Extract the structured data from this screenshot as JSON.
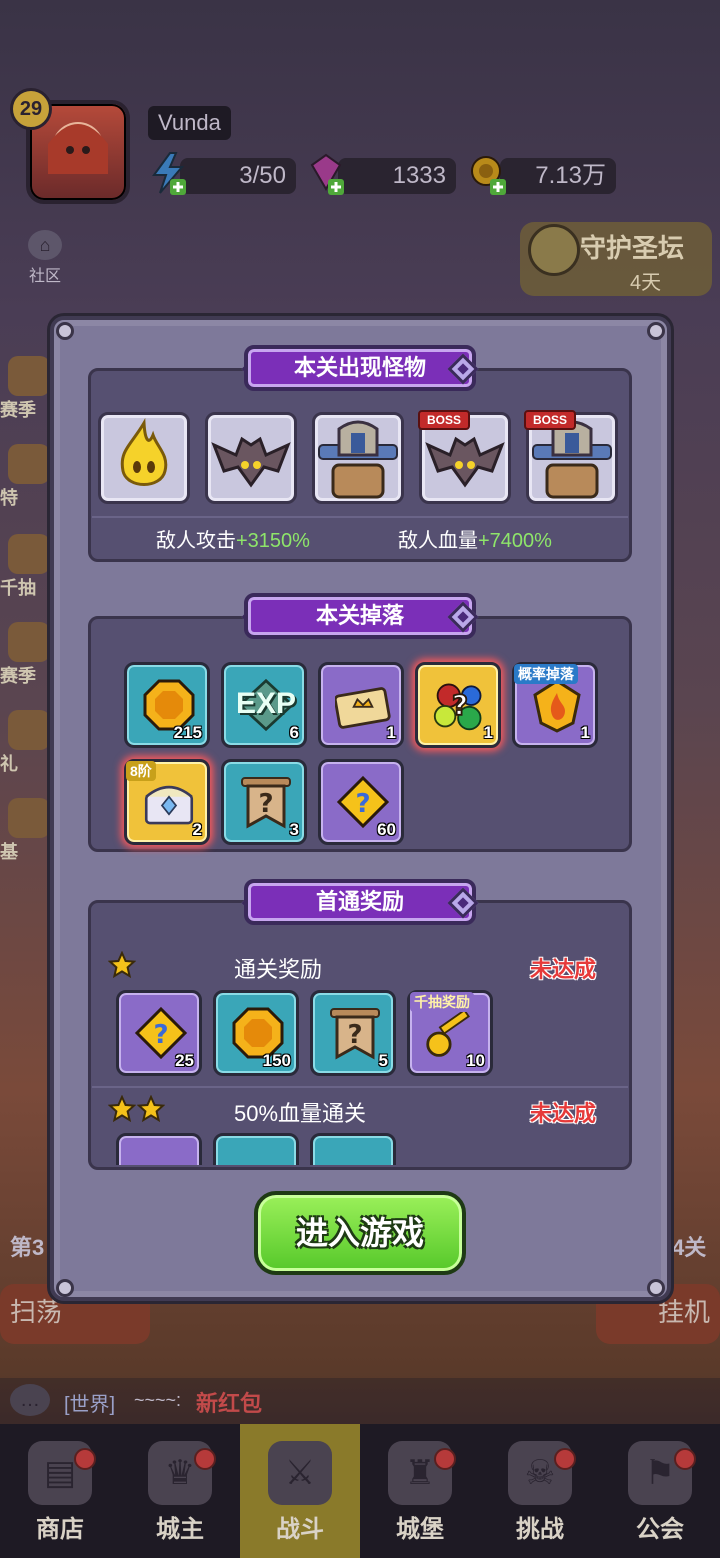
{
  "hud": {
    "level": "29",
    "name": "Vunda",
    "energy": "3/50",
    "gems": "1333",
    "gold": "7.13万",
    "community": "社区",
    "guard_title": "守护圣坛",
    "guard_days": "4天"
  },
  "side_left": [
    "赛季",
    "特",
    "千抽",
    "赛季",
    "礼",
    "基"
  ],
  "background": {
    "stage_left": "第3",
    "stage_right": "4关",
    "sweep": "扫荡",
    "hang": "挂机",
    "chat_channel": "[世界]",
    "chat_user": "~~~~:",
    "chat_msg": "新红包"
  },
  "nav": [
    {
      "label": "商店",
      "icon": "shop-icon",
      "dot": true
    },
    {
      "label": "城主",
      "icon": "crown-icon",
      "dot": true
    },
    {
      "label": "战斗",
      "icon": "swords-icon",
      "dot": false
    },
    {
      "label": "城堡",
      "icon": "castle-icon",
      "dot": true
    },
    {
      "label": "挑战",
      "icon": "demon-icon",
      "dot": true
    },
    {
      "label": "公会",
      "icon": "guild-icon",
      "dot": true
    }
  ],
  "dialog": {
    "monsters": {
      "title": "本关出现怪物",
      "list": [
        {
          "name": "fire-spirit",
          "boss": false
        },
        {
          "name": "dark-bat",
          "boss": false
        },
        {
          "name": "armored-knight",
          "boss": false
        },
        {
          "name": "dark-bat-boss",
          "boss": true
        },
        {
          "name": "armored-knight-boss",
          "boss": true
        }
      ],
      "boss_label": "BOSS",
      "atk_label": "敌人攻击",
      "atk_value": "+3150%",
      "hp_label": "敌人血量",
      "hp_value": "+7400%"
    },
    "drops": {
      "title": "本关掉落",
      "items": [
        {
          "icon": "gold-coin-icon",
          "qty": "215",
          "style": "blue",
          "tag": ""
        },
        {
          "icon": "exp-icon",
          "qty": "6",
          "style": "blue",
          "tag": "",
          "text": "EXP"
        },
        {
          "icon": "ticket-icon",
          "qty": "1",
          "style": "purple",
          "tag": ""
        },
        {
          "icon": "mystery-gems-icon",
          "qty": "1",
          "style": "gold",
          "tag": ""
        },
        {
          "icon": "flame-emblem-icon",
          "qty": "1",
          "style": "purple",
          "tag": "概率掉落"
        },
        {
          "icon": "treasure-chest-icon",
          "qty": "2",
          "style": "gold",
          "tag": "8阶"
        },
        {
          "icon": "mystery-banner-icon",
          "qty": "3",
          "style": "blue",
          "tag": ""
        },
        {
          "icon": "mystery-puzzle-icon",
          "qty": "60",
          "style": "purple",
          "tag": ""
        }
      ]
    },
    "first_clear": {
      "title": "首通奖励",
      "rows": [
        {
          "stars": 1,
          "label": "通关奖励",
          "status": "未达成",
          "items": [
            {
              "icon": "mystery-puzzle-icon",
              "qty": "25",
              "style": "purple",
              "tag": ""
            },
            {
              "icon": "gold-coin-icon",
              "qty": "150",
              "style": "blue",
              "tag": ""
            },
            {
              "icon": "mystery-banner-icon",
              "qty": "5",
              "style": "blue",
              "tag": ""
            },
            {
              "icon": "golden-key-icon",
              "qty": "10",
              "style": "purple",
              "tag": "千抽奖励"
            }
          ]
        },
        {
          "stars": 2,
          "label": "50%血量通关",
          "status": "未达成"
        }
      ]
    },
    "enter_button": "进入游戏"
  }
}
